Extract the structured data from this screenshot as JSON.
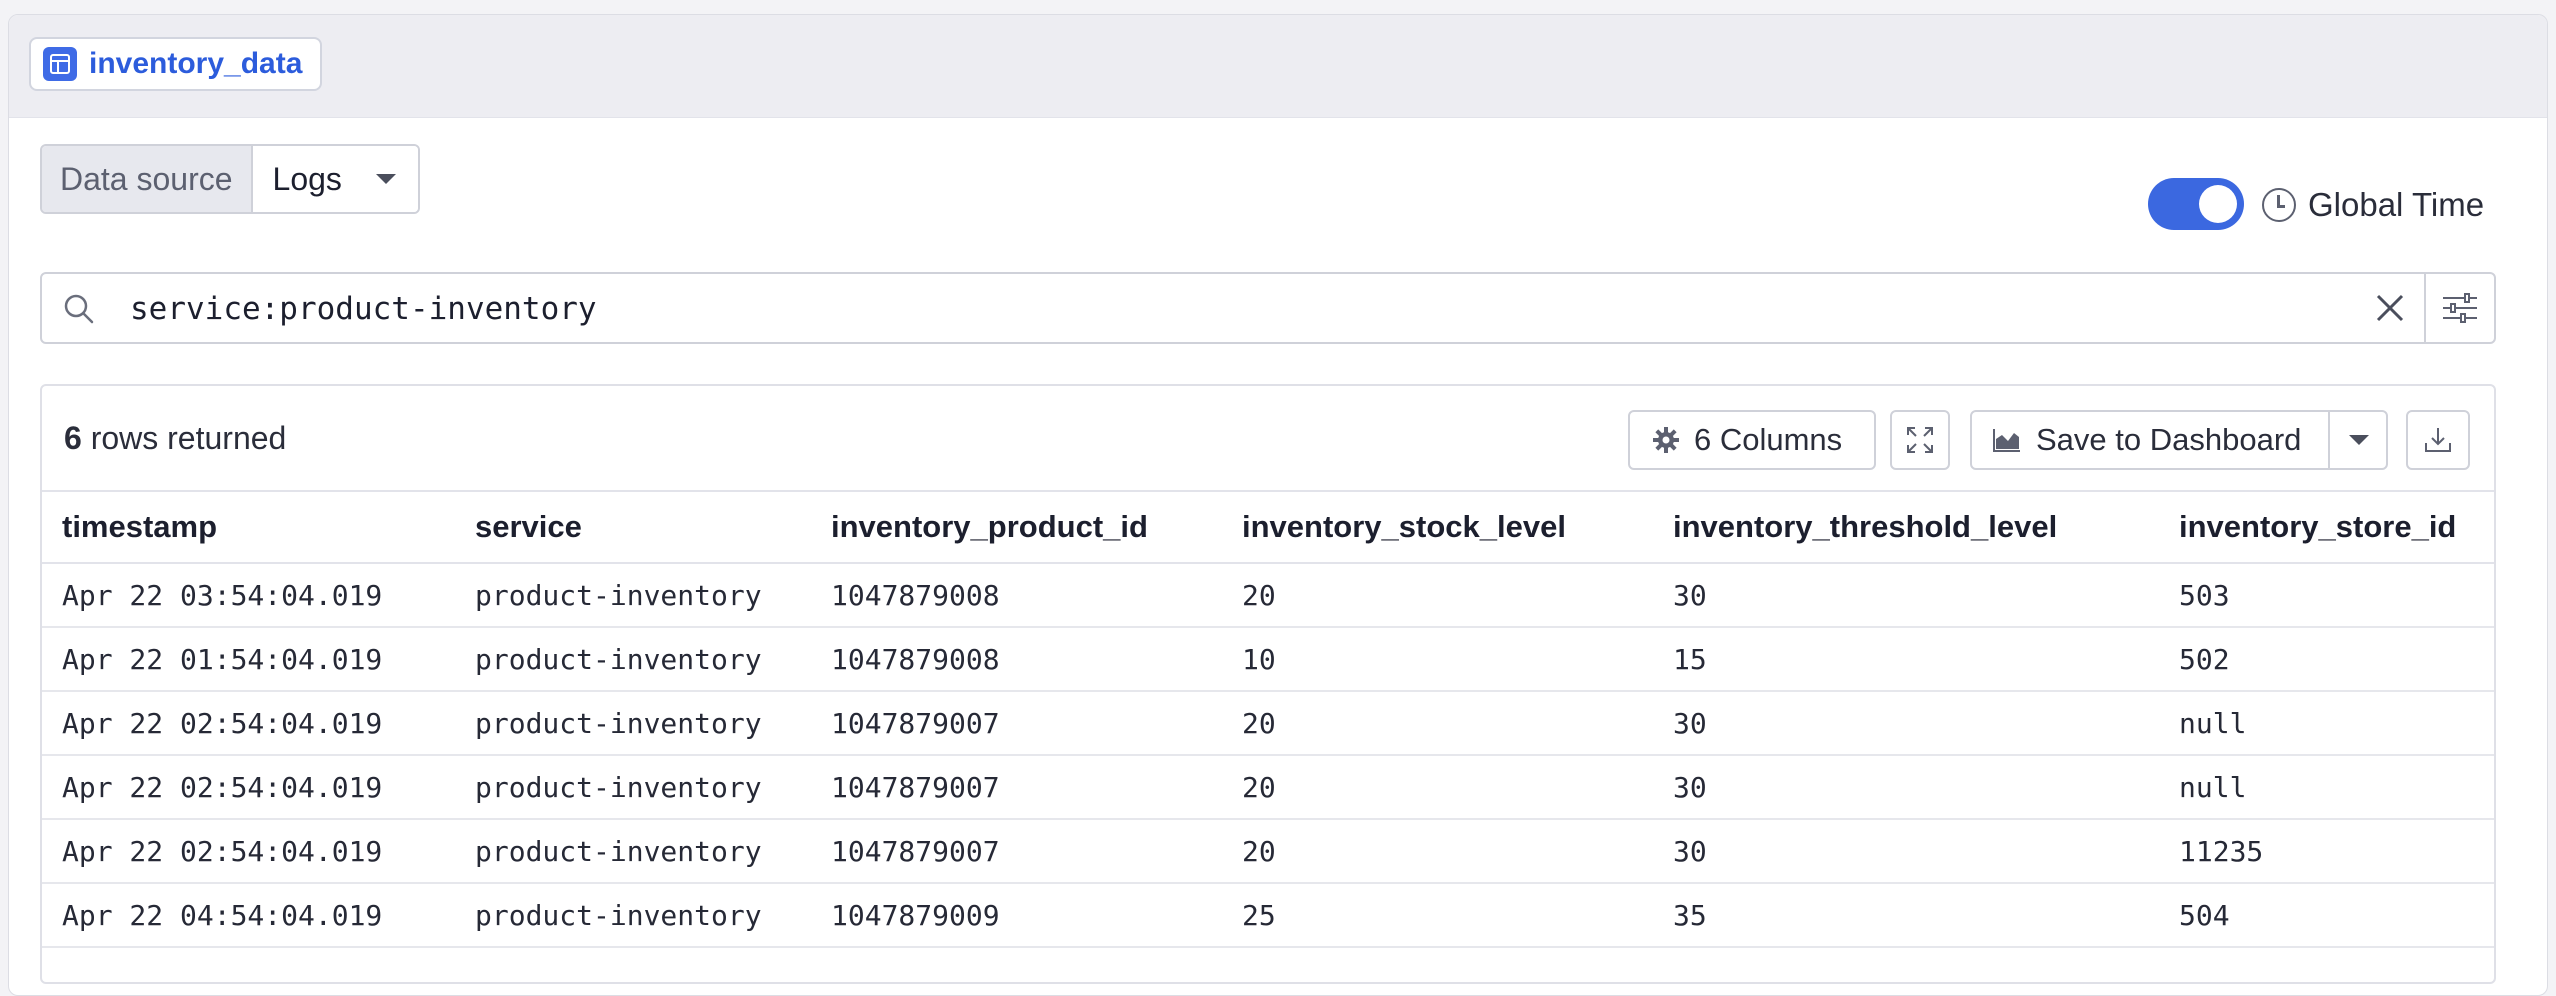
{
  "widget": {
    "title": "inventory_data"
  },
  "data_source": {
    "label": "Data source",
    "value": "Logs"
  },
  "global_time": {
    "label": "Global Time",
    "enabled": true
  },
  "search": {
    "query": "service:product-inventory"
  },
  "results": {
    "row_count": "6",
    "row_count_suffix": " rows returned",
    "columns_button": "6 Columns",
    "save_button": "Save to Dashboard",
    "headers": [
      "timestamp",
      "service",
      "inventory_product_id",
      "inventory_stock_level",
      "inventory_threshold_level",
      "inventory_store_id"
    ],
    "rows": [
      [
        "Apr 22 03:54:04.019",
        "product-inventory",
        "1047879008",
        "20",
        "30",
        "503"
      ],
      [
        "Apr 22 01:54:04.019",
        "product-inventory",
        "1047879008",
        "10",
        "15",
        "502"
      ],
      [
        "Apr 22 02:54:04.019",
        "product-inventory",
        "1047879007",
        "20",
        "30",
        "null"
      ],
      [
        "Apr 22 02:54:04.019",
        "product-inventory",
        "1047879007",
        "20",
        "30",
        "null"
      ],
      [
        "Apr 22 02:54:04.019",
        "product-inventory",
        "1047879007",
        "20",
        "30",
        "11235"
      ],
      [
        "Apr 22 04:54:04.019",
        "product-inventory",
        "1047879009",
        "25",
        "35",
        "504"
      ]
    ]
  },
  "colors": {
    "accent": "#3b68e0",
    "title_text": "#2c5cdc"
  }
}
